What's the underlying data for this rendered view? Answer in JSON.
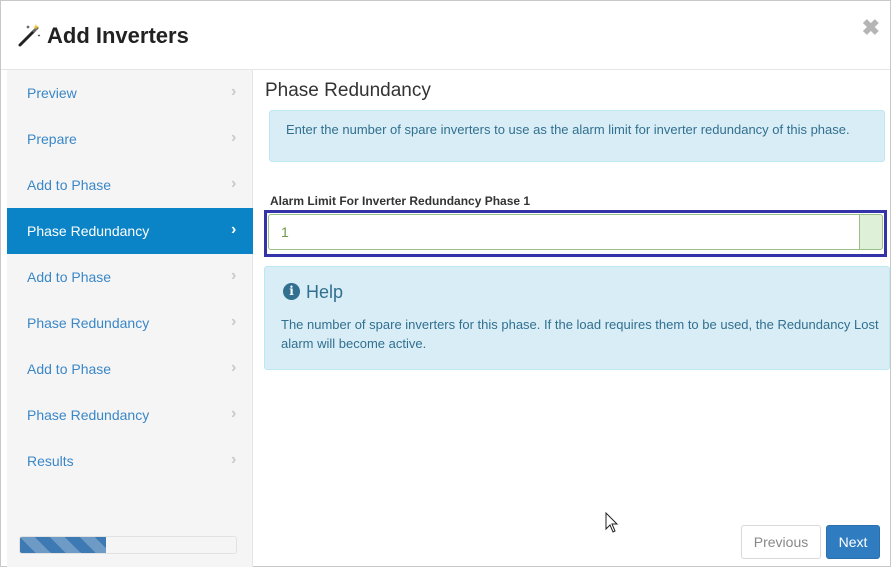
{
  "header": {
    "title": "Add Inverters",
    "wand_icon": "magic-wand-icon",
    "close_icon": "close-icon",
    "close_glyph": "✖"
  },
  "sidebar": {
    "chevron_glyph": "›",
    "items": [
      {
        "label": "Preview",
        "active": false
      },
      {
        "label": "Prepare",
        "active": false
      },
      {
        "label": "Add to Phase",
        "active": false
      },
      {
        "label": "Phase Redundancy",
        "active": true
      },
      {
        "label": "Add to Phase",
        "active": false
      },
      {
        "label": "Phase Redundancy",
        "active": false
      },
      {
        "label": "Add to Phase",
        "active": false
      },
      {
        "label": "Phase Redundancy",
        "active": false
      },
      {
        "label": "Results",
        "active": false
      }
    ],
    "progress_fraction": 0.4
  },
  "main": {
    "heading": "Phase Redundancy",
    "info_text": "Enter the number of spare inverters to use as the alarm limit for inverter redundancy of this phase.",
    "field_label": "Alarm Limit For Inverter Redundancy Phase 1",
    "field_value": "1",
    "help": {
      "icon": "info-circle-icon",
      "icon_glyph": "i",
      "title": "Help",
      "text": "The number of spare inverters for this phase. If the load requires them to be used, the Redundancy Lost alarm will become active."
    }
  },
  "footer": {
    "previous_label": "Previous",
    "next_label": "Next"
  },
  "colors": {
    "active_step": "#0a84c6",
    "link": "#3a87c8",
    "info_bg": "#d9edf7",
    "info_text": "#31708f",
    "highlight_border": "#3533a8",
    "next_button": "#2f7cc1"
  }
}
